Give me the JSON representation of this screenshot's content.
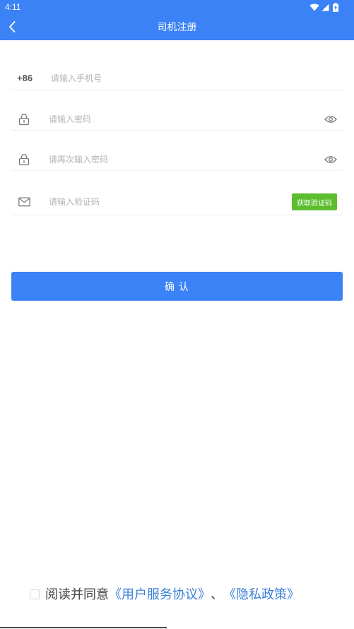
{
  "status_bar": {
    "time": "4:11"
  },
  "header": {
    "title": "司机注册"
  },
  "form": {
    "phone": {
      "prefix": "+86",
      "placeholder": "请输入手机号"
    },
    "password": {
      "placeholder": "请输入密码"
    },
    "confirm_password": {
      "placeholder": "请再次输入密码"
    },
    "verify_code": {
      "placeholder": "请输入验证码",
      "send_label": "获取验证码"
    }
  },
  "confirm_button": {
    "label": "确 认"
  },
  "agreement": {
    "checked": false,
    "prefix": "阅读并同意",
    "user_agreement": "《用户服务协议》",
    "separator": "、",
    "privacy_policy": "《隐私政策》"
  },
  "icons": {
    "back": "chevron-left-icon",
    "wifi": "wifi-icon",
    "signal": "signal-icon",
    "battery": "battery-charging-icon",
    "lock": "lock-icon",
    "eye": "eye-icon",
    "mail": "mail-icon"
  },
  "colors": {
    "primary": "#3b82f6",
    "success": "#5cbd2f",
    "link": "#3a7fd6",
    "text": "#444444",
    "placeholder": "#b3b3b3"
  }
}
